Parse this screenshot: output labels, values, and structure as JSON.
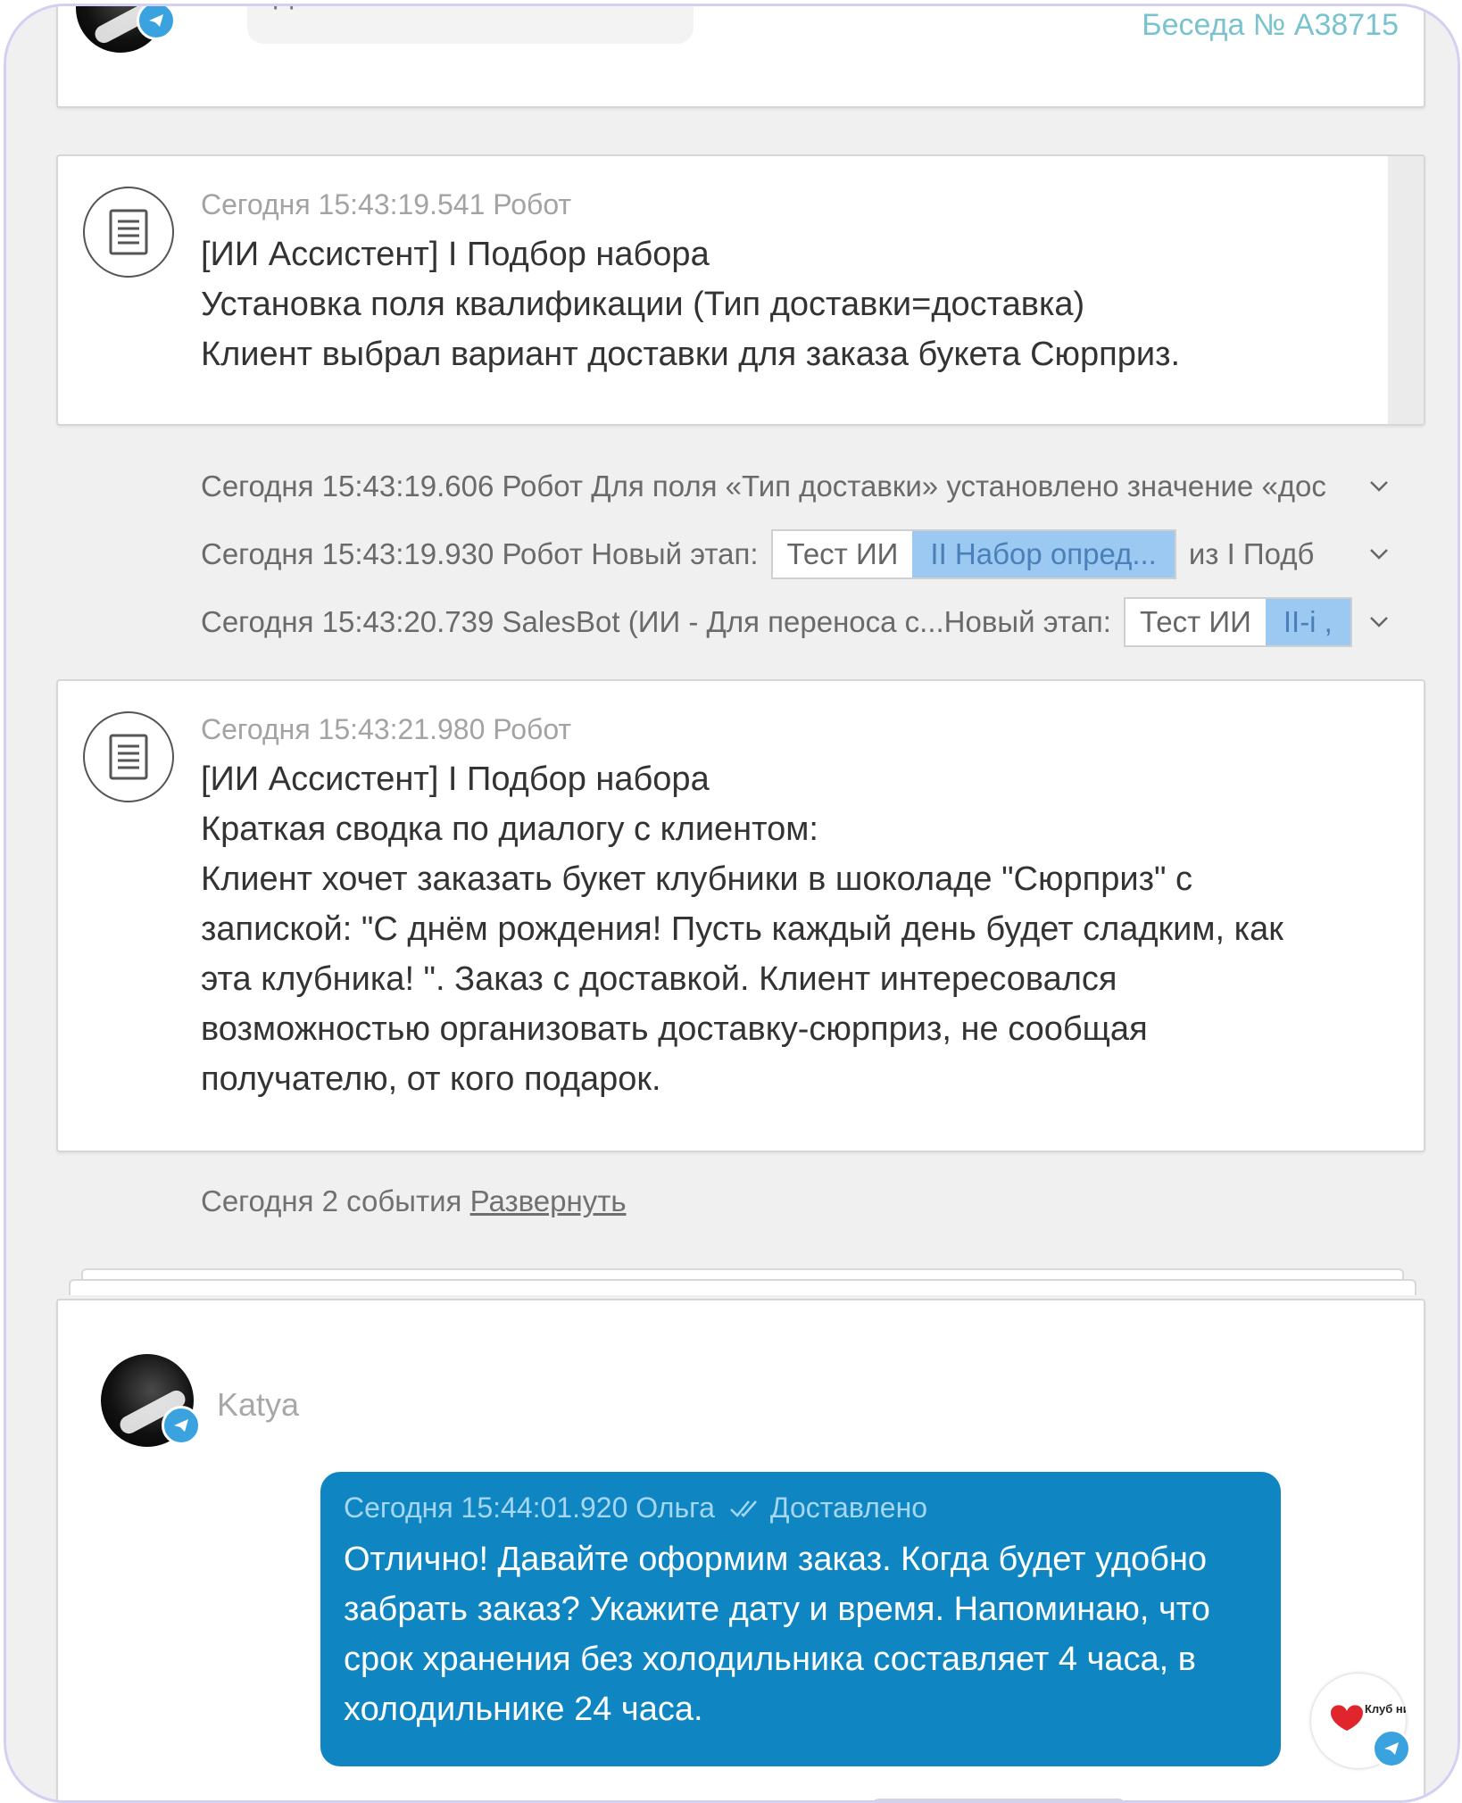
{
  "top": {
    "bubble_text": "Да",
    "conversation_label": "Беседа № А38715"
  },
  "msg1": {
    "meta": "Сегодня 15:43:19.541 Робот",
    "lines": [
      "[ИИ Ассистент] I Подбор набора",
      "Установка поля квалификации (Тип доставки=доставка)",
      "Клиент выбрал вариант доставки для заказа букета Сюрприз."
    ]
  },
  "events": [
    {
      "text": "Сегодня 15:43:19.606 Робот Для поля «Тип доставки» установлено значение «дос"
    },
    {
      "prefix": "Сегодня 15:43:19.930 Робот Новый этап:",
      "chip1": "Тест ИИ",
      "chip2": "II Набор опред...",
      "suffix": "из I Подб"
    },
    {
      "prefix": "Сегодня 15:43:20.739 SalesBot (ИИ - Для переноса с...Новый этап:",
      "chip1": "Тест ИИ",
      "chip2": "II-i ,"
    }
  ],
  "msg2": {
    "meta": "Сегодня 15:43:21.980 Робот",
    "lines": [
      "[ИИ Ассистент] I Подбор набора",
      "Краткая сводка по диалогу с клиентом:",
      "Клиент хочет заказать букет клубники в шоколаде \"Сюрприз\" с",
      "запиской: \"С днём рождения! Пусть каждый день будет сладким, как",
      "эта клубника! \". Заказ с доставкой. Клиент интересовался",
      "возможностью организовать доставку-сюрприз, не сообщая",
      "получателю, от кого подарок."
    ]
  },
  "today_events": {
    "text": "Сегодня 2 события",
    "expand_link": "Развернуть"
  },
  "chat": {
    "user_name": "Katya",
    "message_meta_time": "Сегодня 15:44:01.920 Ольга",
    "message_status": "Доставлено",
    "message_lines": [
      "Отлично! Давайте оформим заказ. Когда будет удобно",
      "забрать заказ? Укажите дату и время. Напоминаю, что",
      "срок хранения без холодильника составляет 4 часа, в",
      "холодильнике 24 часа."
    ],
    "brand_text": "Клуб ни"
  },
  "colors": {
    "bubble_blue": "#0f86c2",
    "chip_highlight": "#9cc9f2",
    "telegram_blue": "#3aa3df"
  }
}
